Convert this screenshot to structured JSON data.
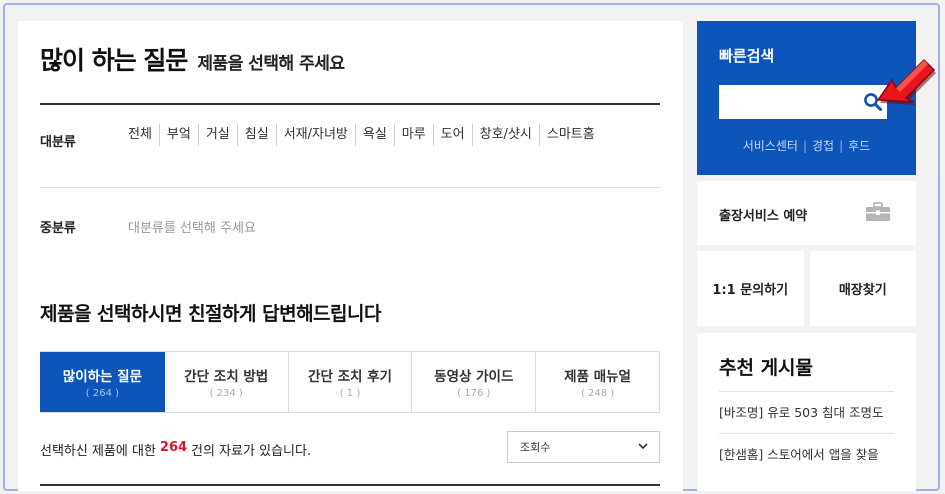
{
  "main": {
    "title": "많이 하는 질문",
    "title_sub": "제품을 선택해 주세요",
    "category_label": "대분류",
    "categories": [
      "전체",
      "부엌",
      "거실",
      "침실",
      "서재/자녀방",
      "욕실",
      "마루",
      "도어",
      "창호/샷시",
      "스마트홈"
    ],
    "subcategory_label": "중분류",
    "subcategory_placeholder": "대분류를 선택해 주세요",
    "subtitle": "제품을 선택하시면 친절하게 답변해드립니다",
    "tabs": [
      {
        "label": "많이하는 질문",
        "count": "( 264 )",
        "active": true
      },
      {
        "label": "간단 조치 방법",
        "count": "( 234 )",
        "active": false
      },
      {
        "label": "간단 조치 후기",
        "count": "( 1 )",
        "active": false
      },
      {
        "label": "동영상 가이드",
        "count": "( 176 )",
        "active": false
      },
      {
        "label": "제품 매뉴얼",
        "count": "( 248 )",
        "active": false
      }
    ],
    "result_prefix": "선택하신 제품에 대한",
    "result_count": "264",
    "result_suffix": "건의 자료가 있습니다.",
    "sort_value": "조회수"
  },
  "sidebar": {
    "quick_search_title": "빠른검색",
    "search_value": "",
    "links": [
      "서비스센터",
      "경첩",
      "후드"
    ],
    "service_booking": "출장서비스 예약",
    "inquiry": "1:1 문의하기",
    "store_finder": "매장찾기",
    "recommended_title": "추천 게시물",
    "recommended": [
      "[바조명] 유로 503 침대 조명도",
      "[한샘홈] 스토어에서 앱을 찾을"
    ]
  },
  "colors": {
    "brand_blue": "#0d55b8",
    "count_red": "#d0192f",
    "arrow_red": "#e8141e"
  },
  "icons": [
    "search-icon",
    "briefcase-icon",
    "chevron-down-icon",
    "red-arrow-icon"
  ]
}
